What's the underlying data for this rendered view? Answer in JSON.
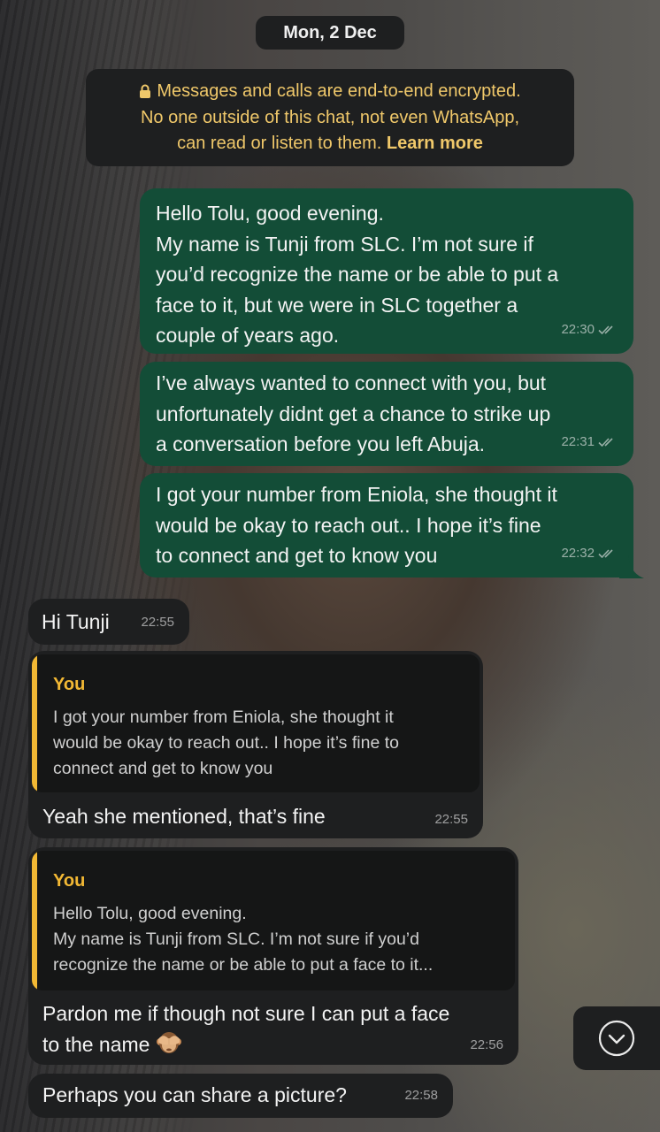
{
  "date_separator": "Mon, 2 Dec",
  "encryption_notice": {
    "line1": "Messages and calls are end-to-end encrypted.",
    "line2": "No one outside of this chat, not even WhatsApp,",
    "line3_prefix": "can read or listen to them.",
    "link": "Learn more",
    "icon": "lock-icon"
  },
  "messages": [
    {
      "direction": "outgoing",
      "text": "Hello Tolu, good evening.\nMy name is Tunji from SLC. I’m not sure if\nyou’d recognize the name or be able to put a\nface to it, but we were in SLC together a\ncouple of years ago.",
      "time": "22:30",
      "status": "read"
    },
    {
      "direction": "outgoing",
      "text": "I’ve always wanted to connect with you, but\nunfortunately didnt get a chance to strike up\na conversation before you left Abuja.",
      "time": "22:31",
      "status": "read"
    },
    {
      "direction": "outgoing",
      "text": "I got your number from Eniola, she thought it\nwould be okay to reach out.. I hope it’s fine\nto connect and get to know you",
      "time": "22:32",
      "status": "read"
    },
    {
      "direction": "incoming",
      "text": "Hi Tunji",
      "time": "22:55"
    },
    {
      "direction": "incoming",
      "quote": {
        "author": "You",
        "text": "I got your number from Eniola, she thought it\nwould be okay to reach out.. I hope it’s fine to\nconnect and get to know you"
      },
      "text": "Yeah she mentioned, that’s fine",
      "time": "22:55"
    },
    {
      "direction": "incoming",
      "quote": {
        "author": "You",
        "text": "Hello Tolu, good evening.\nMy name is Tunji from SLC. I’m not sure if you’d\nrecognize the name or be able to put a face to it..."
      },
      "text": "Pardon me if though not sure I can put a face\nto the name",
      "emoji": "see-no-evil-monkey-icon",
      "time": "22:56"
    },
    {
      "direction": "incoming",
      "text": "Perhaps you can share a picture?",
      "time": "22:58"
    }
  ],
  "scroll_down_button": {
    "icon": "chevron-down-circle-icon"
  },
  "colors": {
    "outgoing_bubble": "#134d37",
    "incoming_bubble": "#1e1f20",
    "quote_accent": "#f2b834",
    "encryption_text": "#f0c86a"
  }
}
